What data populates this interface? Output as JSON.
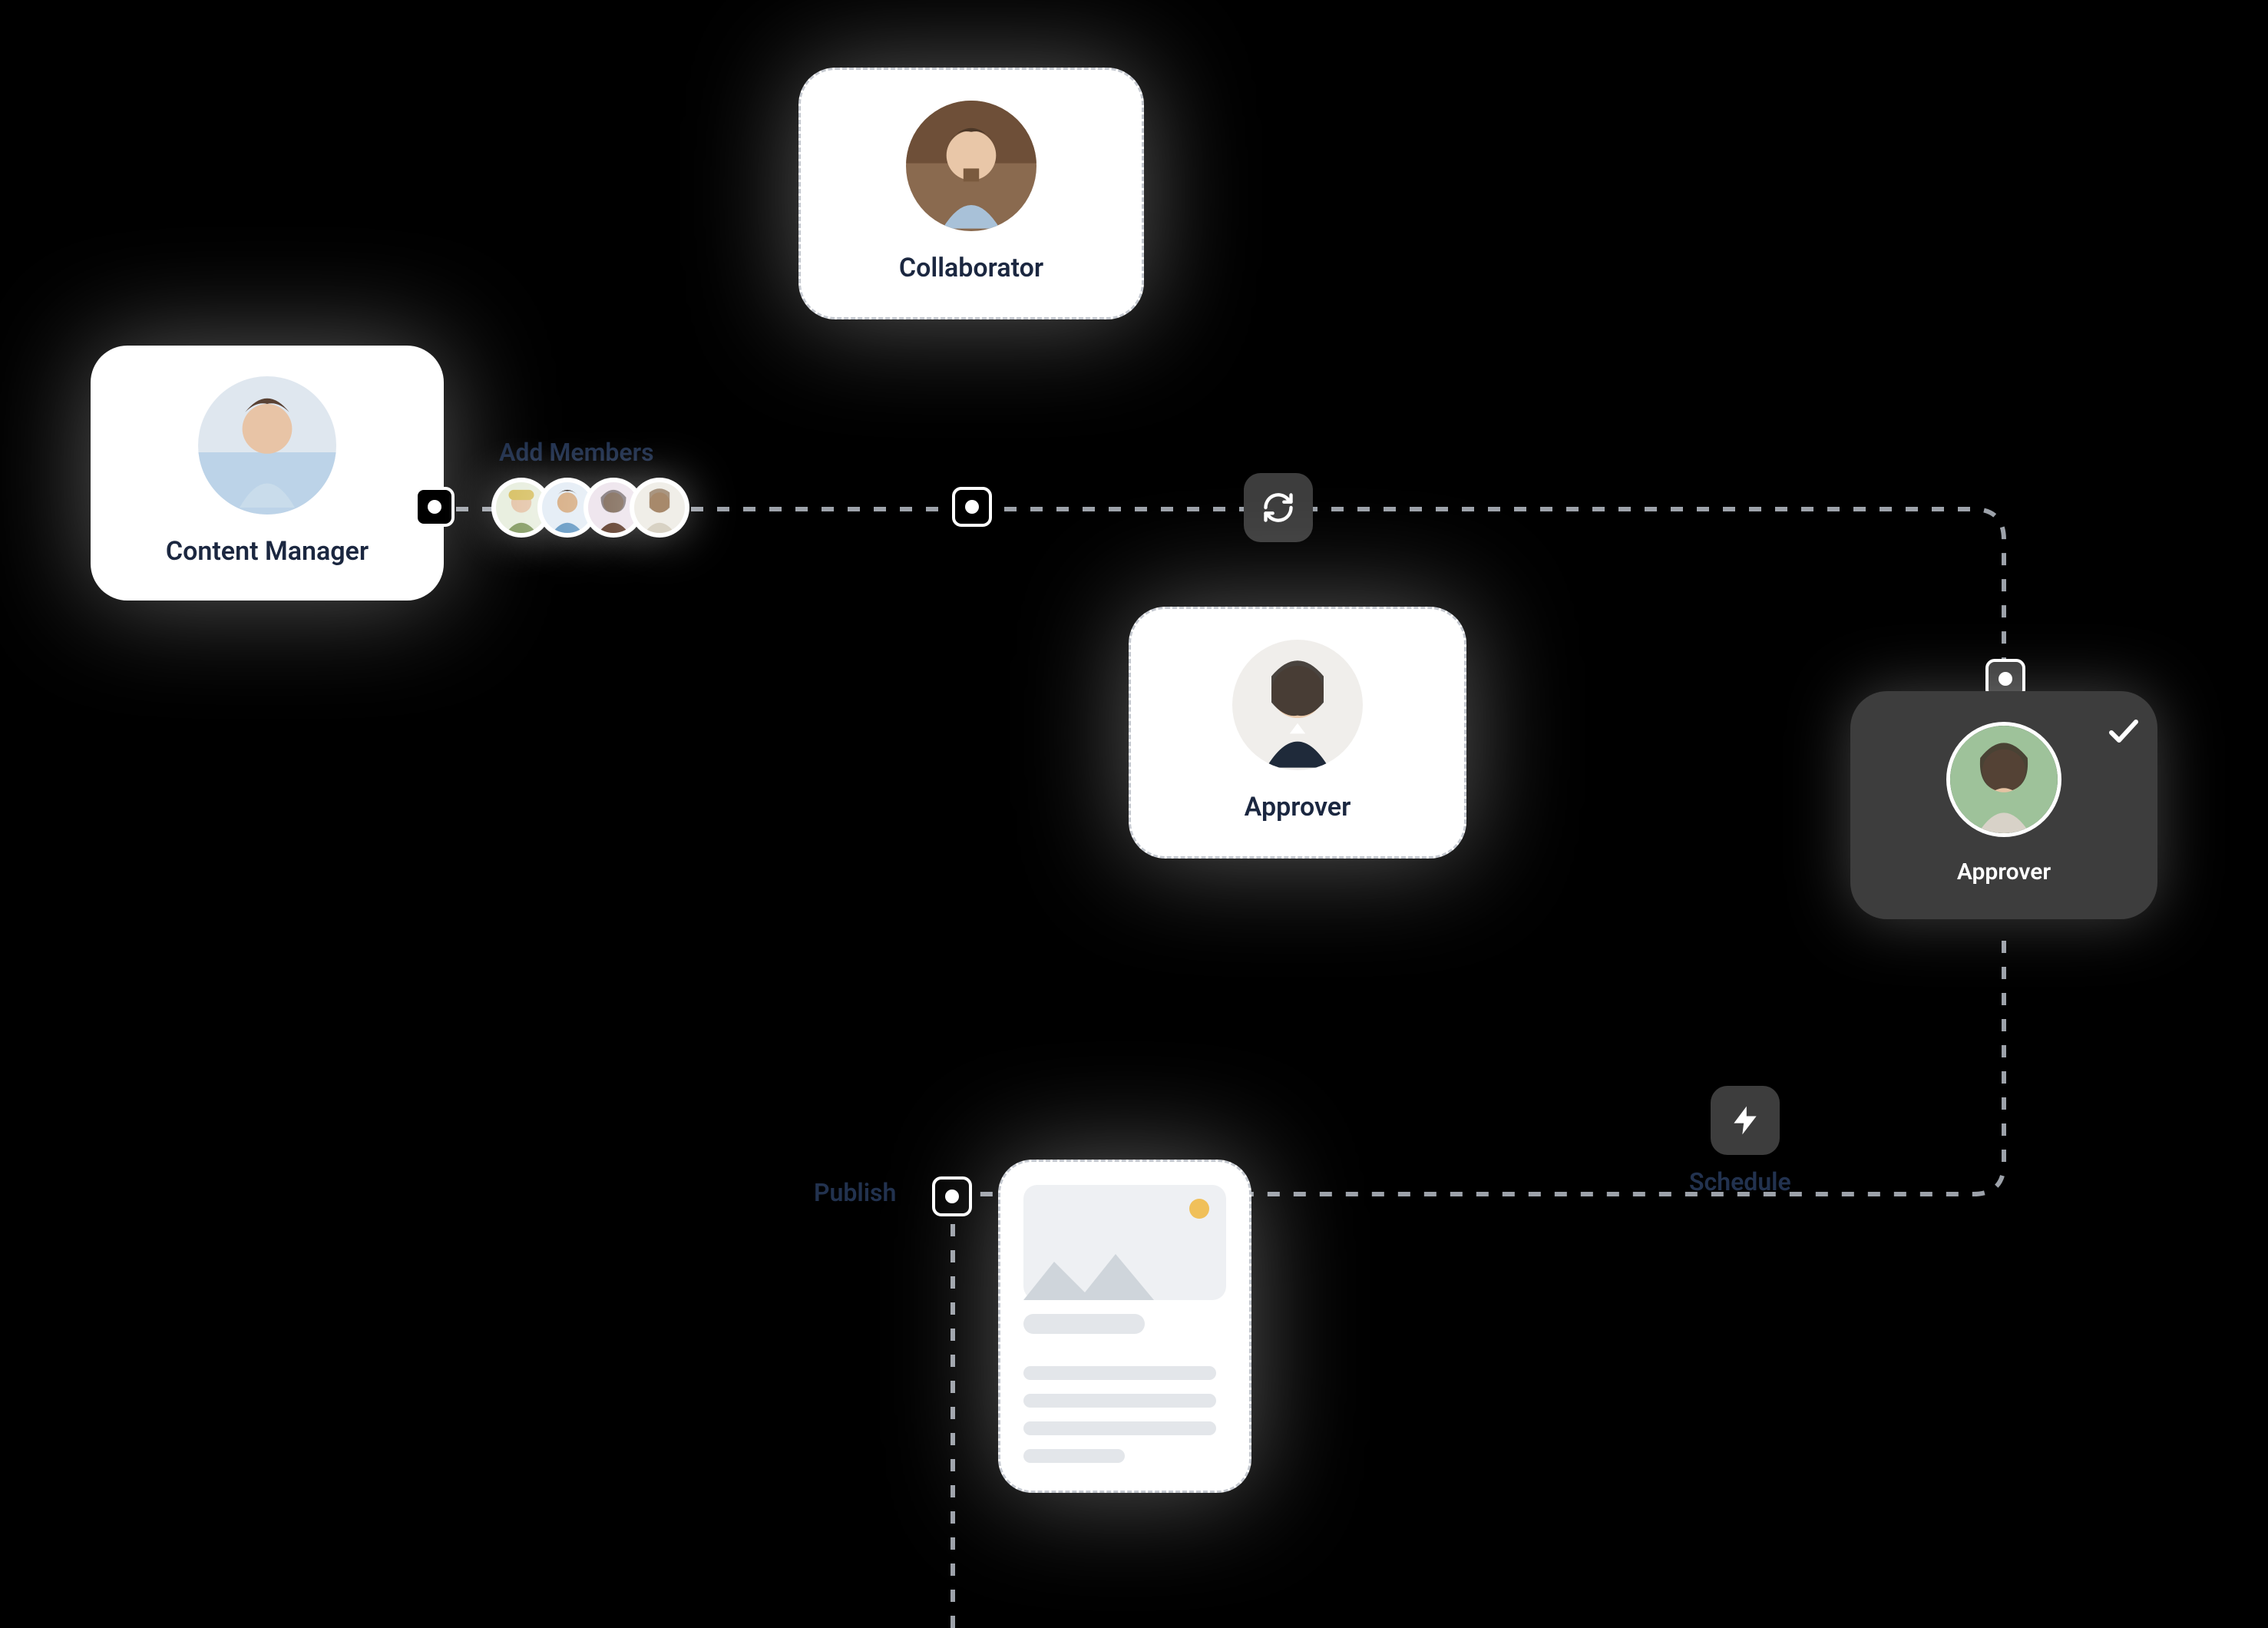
{
  "workflow": {
    "content_manager": {
      "label": "Content Manager"
    },
    "collaborator": {
      "label": "Collaborator"
    },
    "approver_primary": {
      "label": "Approver"
    },
    "approver_final": {
      "label": "Approver"
    },
    "add_members_label": "Add Members",
    "publish_label": "Publish",
    "schedule_label": "Schedule"
  }
}
